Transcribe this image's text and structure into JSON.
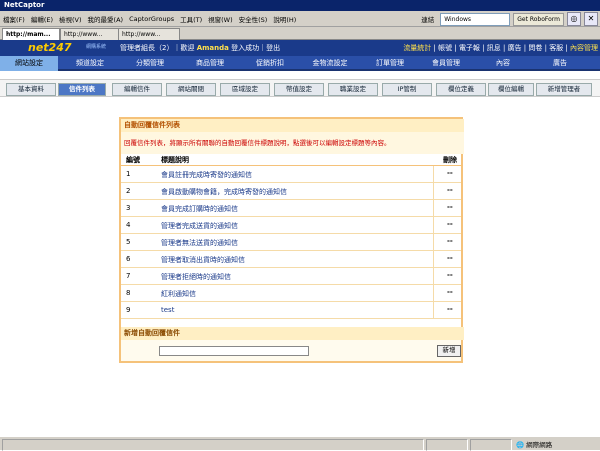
{
  "window": {
    "title": "NetCaptor"
  },
  "menubar": {
    "items": [
      "檔案(F)",
      "編輯(E)",
      "檢視(V)",
      "我的最愛(A)",
      "CaptorGroups",
      "工具(T)",
      "視窗(W)",
      "安全性(S)",
      "說明(H)"
    ],
    "url_label": "連結",
    "url_value": "Windows",
    "robo_label": "Get RoboForm"
  },
  "browser_tabs": [
    "http://mam...",
    "http://www...",
    "http://www..."
  ],
  "header": {
    "logo": "net247",
    "logo_sub": "網購系統",
    "welcome_prefix": "管理者組長（2）｜歡迎",
    "welcome_user": "Amanda",
    "welcome_suffix": "登入成功｜登出",
    "links": [
      "流量統計",
      "帳號",
      "電子報",
      "訊息",
      "廣告",
      "問卷",
      "客服",
      "內容管理"
    ]
  },
  "main_nav": [
    "網站設定",
    "頻道設定",
    "分類管理",
    "商品管理",
    "促銷折扣",
    "金物流設定",
    "訂單管理",
    "會員管理",
    "內容",
    "廣告"
  ],
  "sub_nav": [
    "基本資料",
    "信件列表",
    "編輯信件",
    "網站關閉",
    "區域設定",
    "幣值設定",
    "職業設定",
    "IP管制",
    "欄位定義",
    "欄位編輯",
    "新增管理者"
  ],
  "panel": {
    "title": "自動回覆信件列表",
    "description": "回覆信件列表，將顯示所有關聯的自動回覆信件標題說明，點選後可以編輯設定標題等內容。",
    "col_num": "編號",
    "col_title": "標題說明",
    "col_delete": "刪除",
    "rows": [
      {
        "num": "1",
        "desc": "會員註冊完成時寄發的通知信",
        "del": "--"
      },
      {
        "num": "2",
        "desc": "會員啟動購物會籍，完成時寄發的通知信",
        "del": "--"
      },
      {
        "num": "3",
        "desc": "會員完成訂購時的通知信",
        "del": "--"
      },
      {
        "num": "4",
        "desc": "管理者完成送貨的通知信",
        "del": "--"
      },
      {
        "num": "5",
        "desc": "管理者無法送貨的通知信",
        "del": "--"
      },
      {
        "num": "6",
        "desc": "管理者取消出貨時的通知信",
        "del": "--"
      },
      {
        "num": "7",
        "desc": "管理者拒絕時的通知信",
        "del": "--"
      },
      {
        "num": "8",
        "desc": "紅利通知信",
        "del": "--"
      },
      {
        "num": "9",
        "desc": "test",
        "del": "--"
      }
    ],
    "add_title": "新增自動回覆信件",
    "input_value": "",
    "add_button": "新增"
  },
  "statusbar": {
    "text": "網際網路"
  }
}
